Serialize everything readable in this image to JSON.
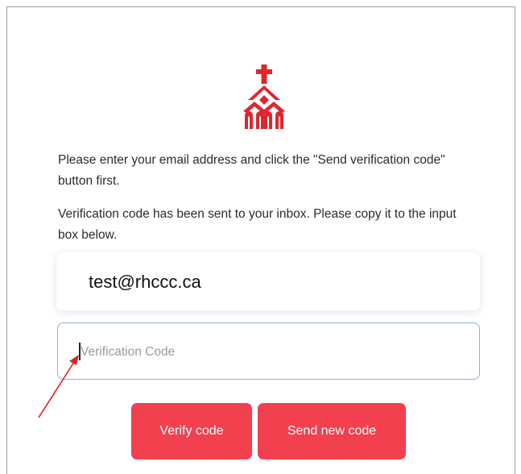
{
  "instructions": {
    "line1": "Please enter your email address and click the \"Send verification code\" button first.",
    "line2": "Verification code has been sent to your inbox. Please copy it to the input box below."
  },
  "email": {
    "value": "test@rhccc.ca"
  },
  "verification": {
    "placeholder": "Verification Code",
    "value": ""
  },
  "buttons": {
    "verify": "Verify code",
    "send_new": "Send new code"
  },
  "colors": {
    "accent": "#f2404e",
    "logo": "#e0262d",
    "annotation_arrow": "#e02020",
    "input_focus_border": "#8ab1d9"
  },
  "icons": {
    "logo": "church-logo-icon",
    "annotation": "red-arrow-annotation"
  }
}
